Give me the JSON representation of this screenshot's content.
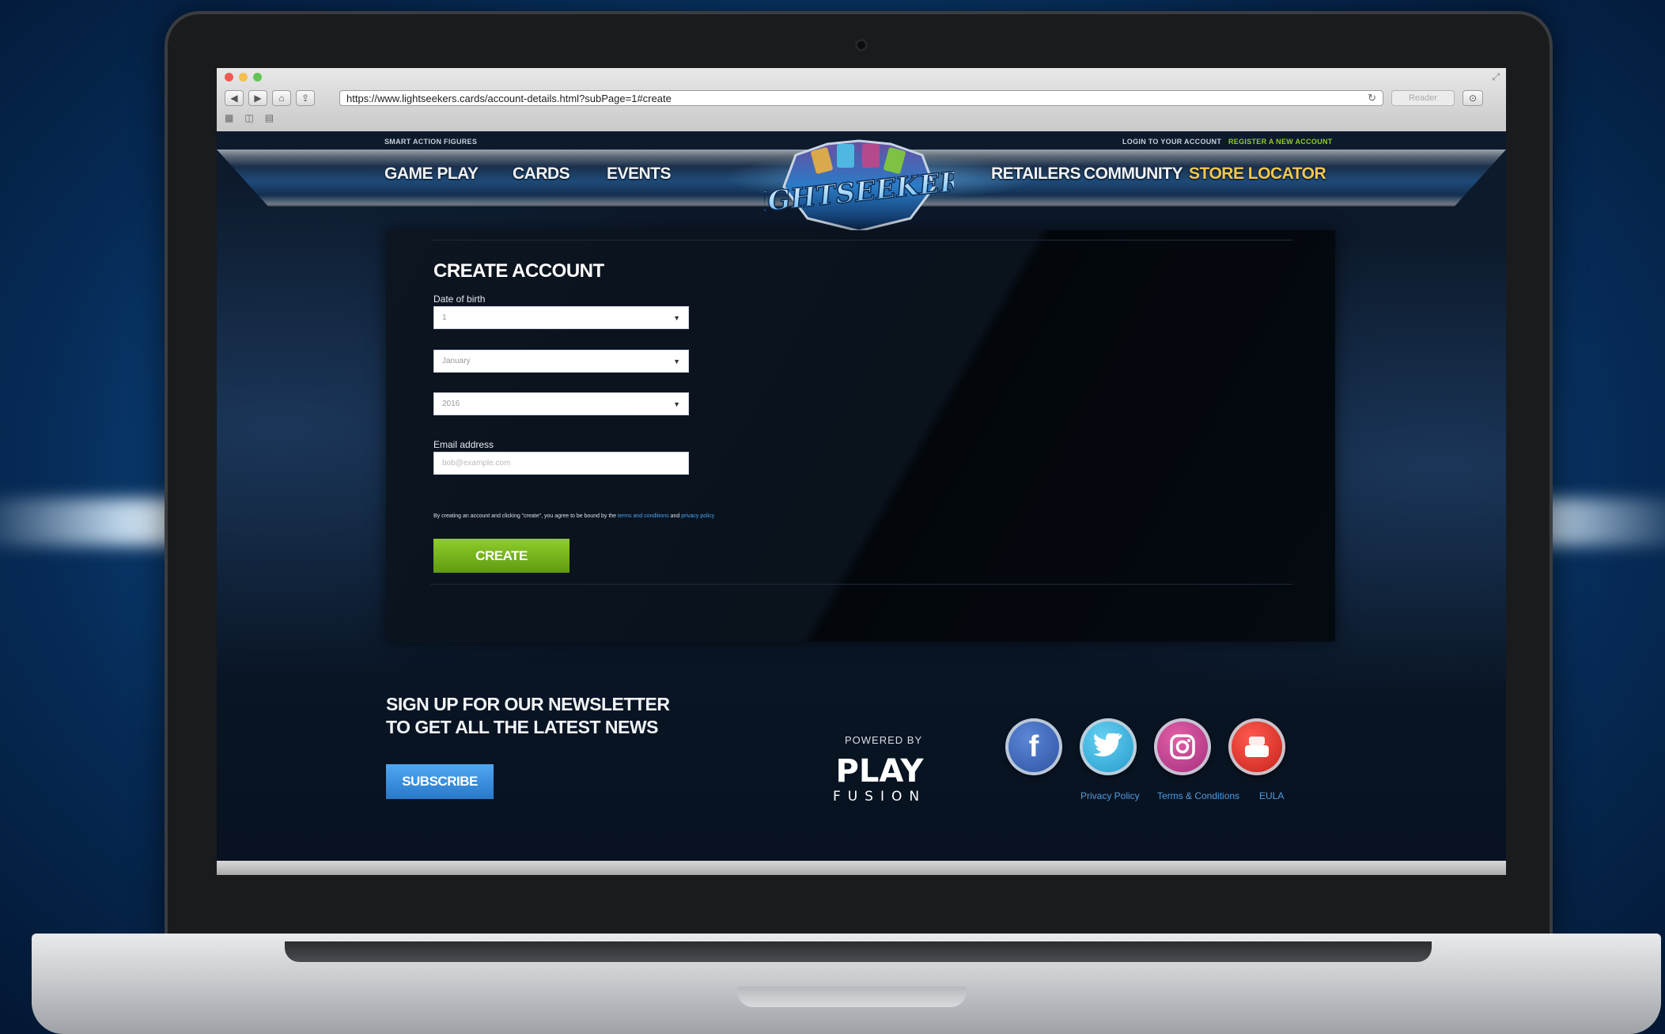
{
  "browser": {
    "url": "https://www.lightseekers.cards/account-details.html?subPage=1#create",
    "reader_label": "Reader"
  },
  "site": {
    "topbar": {
      "left_text": "SMART ACTION FIGURES",
      "login_text": "LOGIN TO YOUR ACCOUNT",
      "register_text": "REGISTER A NEW ACCOUNT"
    },
    "logo_text": "LIGHTSEEKERS",
    "nav": {
      "left": [
        "GAME PLAY",
        "CARDS",
        "EVENTS"
      ],
      "right": [
        "RETAILERS",
        "COMMUNITY",
        "STORE LOCATOR"
      ]
    },
    "form": {
      "title": "CREATE ACCOUNT",
      "dob_label": "Date of birth",
      "day_value": "1",
      "month_value": "January",
      "year_value": "2016",
      "email_label": "Email address",
      "email_placeholder": "bob@example.com",
      "terms_prefix": "By creating an account and clicking \"create\", you agree to be bound by the",
      "terms_link": "terms and conditions",
      "terms_and": "and",
      "privacy_link": "privacy policy",
      "create_label": "CREATE"
    },
    "footer": {
      "newsletter_line1": "SIGN UP FOR OUR NEWSLETTER",
      "newsletter_line2": "TO GET ALL THE LATEST NEWS",
      "subscribe_label": "SUBSCRIBE",
      "powered_by": "POWERED BY",
      "brand_top": "PLAY",
      "brand_bottom": "FUSION",
      "social": [
        "facebook-icon",
        "twitter-icon",
        "instagram-icon",
        "youtube-icon"
      ],
      "links": [
        "Privacy Policy",
        "Terms & Conditions",
        "EULA"
      ]
    }
  },
  "colors": {
    "accent_green": "#7cbf1e",
    "accent_blue": "#3b93e6",
    "nav_gold": "#f2c94c"
  }
}
